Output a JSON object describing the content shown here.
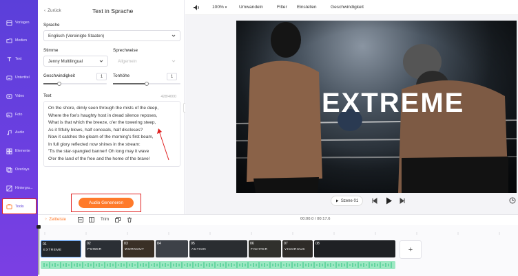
{
  "nav": {
    "items": [
      {
        "label": "Vorlagen",
        "icon": "template-icon"
      },
      {
        "label": "Medien",
        "icon": "media-folder-icon"
      },
      {
        "label": "Text",
        "icon": "text-icon"
      },
      {
        "label": "Untertitel",
        "icon": "subtitle-icon"
      },
      {
        "label": "Video",
        "icon": "video-icon"
      },
      {
        "label": "Foto",
        "icon": "photo-icon"
      },
      {
        "label": "Audio",
        "icon": "music-icon"
      },
      {
        "label": "Elemente",
        "icon": "elements-icon"
      },
      {
        "label": "Overlays",
        "icon": "overlay-icon"
      },
      {
        "label": "Hintergru...",
        "icon": "background-icon"
      }
    ],
    "tools_label": "Tools"
  },
  "panel": {
    "back_label": "Zurück",
    "title": "Text in Sprache",
    "language_label": "Sprache",
    "language_value": "Englisch (Vereinigte Staaten)",
    "voice_label": "Stimme",
    "voice_value": "Jenny Multilingual",
    "style_label": "Sprechweise",
    "style_value": "Allgemein",
    "speed_label": "Geschwindigkeit",
    "speed_value": "1",
    "speed_level": 0.25,
    "pitch_label": "Tonhöhe",
    "pitch_value": "1",
    "pitch_level": 0.5,
    "text_label": "Text",
    "text_counter": "428/4000",
    "text_value": "On the shore, dimly seen through the mists of the deep,\nWhere the foe's haughty host in dread silence reposes,\nWhat is that which the breeze, o'er the towering steep,\nAs it fitfully blows, half conceals, half discloses?\nNow it catches the gleam of the morning's first beam,\nIn full glory reflected now shines in the stream:\n'Tis the star-spangled banner!  Oh long may it wave\nO'er the land of the free and the home of the brave!",
    "generate_label": "Audio Generieren"
  },
  "toolbar": {
    "zoom": "100%",
    "convert": "Umwandeln",
    "filter": "Filter",
    "settings": "Einstellen",
    "speed": "Geschwindigkeit"
  },
  "preview": {
    "overlay_text": "EXTREME",
    "scene_label": "Szene 01",
    "colors": {
      "accent": "#ff7a2a",
      "nav": "#5b3fd9",
      "highlight": "#e02020"
    }
  },
  "timeline": {
    "mode_label": "Zeitleiste",
    "trim_label": "Trim",
    "time_display": "00:00.0 / 00:17.6",
    "clips": [
      {
        "num": "01",
        "text": "EXTREME"
      },
      {
        "num": "02",
        "text": "POWER"
      },
      {
        "num": "03",
        "text": "WORKOUT"
      },
      {
        "num": "04",
        "text": ""
      },
      {
        "num": "05",
        "text": "ACTION"
      },
      {
        "num": "06",
        "text": "FIGHTER"
      },
      {
        "num": "07",
        "text": "VIGOROUS"
      },
      {
        "num": "08",
        "text": ""
      }
    ]
  }
}
